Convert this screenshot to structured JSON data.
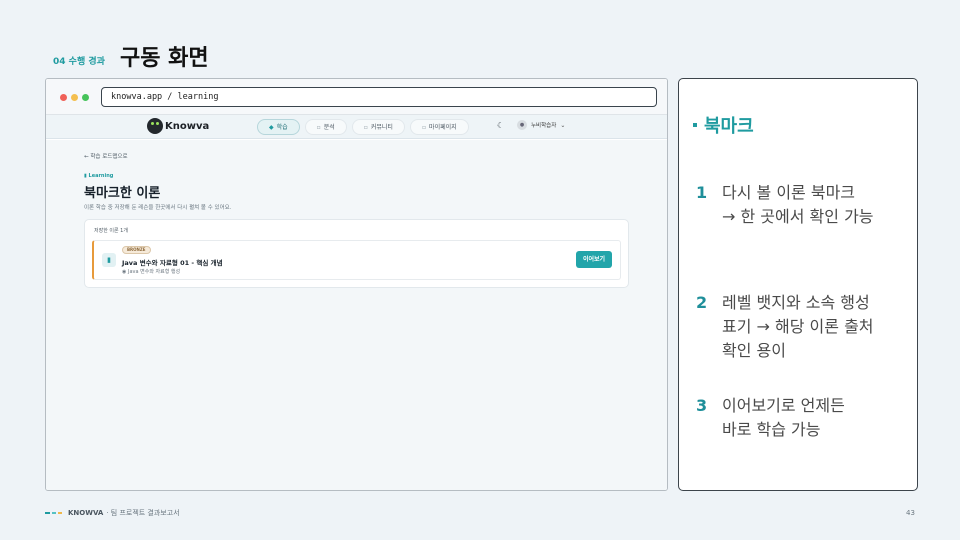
{
  "slide": {
    "section": "04 수행 경과",
    "title": "구동 화면",
    "footer_brand": "KNOWVA",
    "footer_text": "· 팀 프로젝트 결과보고서",
    "page_number": "43"
  },
  "browser": {
    "url": "knowva.app / learning"
  },
  "app": {
    "logo": "Knowva",
    "nav": [
      {
        "icon": "learn-icon",
        "glyph": "◆",
        "label": "학습",
        "active": true
      },
      {
        "icon": "analysis-icon",
        "glyph": "▫",
        "label": "분석",
        "active": false
      },
      {
        "icon": "community-icon",
        "glyph": "▫",
        "label": "커뮤니티",
        "active": false
      },
      {
        "icon": "mypage-icon",
        "glyph": "▫",
        "label": "마이페이지",
        "active": false
      }
    ],
    "user_name": "누비학습자",
    "back_link": "← 학습 로드맵으로",
    "pretitle": "Learning",
    "page_title": "북마크한 이론",
    "page_desc": "이론 학습 중 저장해 둔 레슨을 한곳에서 다시 펼쳐 볼 수 있어요.",
    "saved_count": "저장한 이론 1개",
    "item": {
      "badge": "BRONZE",
      "title": "Java 변수와 자료형 01 - 핵심 개념",
      "source": "Java 변수와 자료형 행성",
      "button": "이어보기"
    }
  },
  "panel": {
    "title": "북마크",
    "points": [
      {
        "num": "1",
        "lines": [
          "다시 볼 이론 북마크",
          "→ 한 곳에서 확인 가능"
        ]
      },
      {
        "num": "2",
        "lines": [
          "레벨 뱃지와 소속 행성",
          "표기 → 해당 이론 출처",
          "확인 용이"
        ]
      },
      {
        "num": "3",
        "lines": [
          "이어보기로 언제든",
          "바로 학습 가능"
        ]
      }
    ]
  },
  "colors": {
    "accent": "#1f9ba0",
    "badge_border": "#e79a3b",
    "button": "#22a5aa"
  }
}
